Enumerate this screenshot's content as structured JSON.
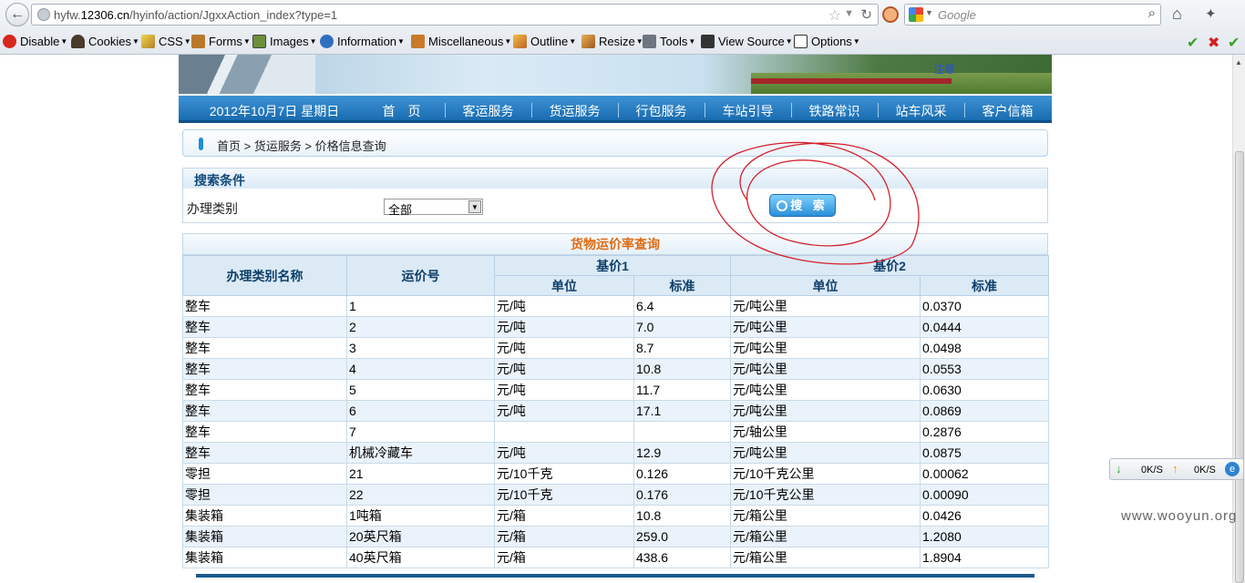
{
  "browser": {
    "url_prefix": "hyfw.",
    "url_domain": "12306.cn",
    "url_path": "/hyinfo/action/JgxxAction_index?type=1",
    "search_engine_placeholder": "Google"
  },
  "devbar": {
    "items": [
      "Disable",
      "Cookies",
      "CSS",
      "Forms",
      "Images",
      "Information",
      "Miscellaneous",
      "Outline",
      "Resize",
      "Tools",
      "View Source",
      "Options"
    ]
  },
  "banner": {
    "note": "注意"
  },
  "nav": {
    "date": "2012年10月7日 星期日",
    "items": [
      "首　页",
      "客运服务",
      "货运服务",
      "行包服务",
      "车站引导",
      "铁路常识",
      "站车风采",
      "客户信箱"
    ]
  },
  "breadcrumb": "首页 > 货运服务 > 价格信息查询",
  "search": {
    "title": "搜索条件",
    "label": "办理类别",
    "select_value": "全部",
    "button_label": "搜 索"
  },
  "rate": {
    "title": "货物运价率查询",
    "headers": {
      "category": "办理类别名称",
      "rate_no": "运价号",
      "base1": "基价1",
      "base2": "基价2",
      "unit": "单位",
      "standard": "标准"
    },
    "rows": [
      [
        "整车",
        "1",
        "元/吨",
        "6.4",
        "元/吨公里",
        "0.0370"
      ],
      [
        "整车",
        "2",
        "元/吨",
        "7.0",
        "元/吨公里",
        "0.0444"
      ],
      [
        "整车",
        "3",
        "元/吨",
        "8.7",
        "元/吨公里",
        "0.0498"
      ],
      [
        "整车",
        "4",
        "元/吨",
        "10.8",
        "元/吨公里",
        "0.0553"
      ],
      [
        "整车",
        "5",
        "元/吨",
        "11.7",
        "元/吨公里",
        "0.0630"
      ],
      [
        "整车",
        "6",
        "元/吨",
        "17.1",
        "元/吨公里",
        "0.0869"
      ],
      [
        "整车",
        "7",
        "",
        "",
        "元/轴公里",
        "0.2876"
      ],
      [
        "整车",
        "机械冷藏车",
        "元/吨",
        "12.9",
        "元/吨公里",
        "0.0875"
      ],
      [
        "零担",
        "21",
        "元/10千克",
        "0.126",
        "元/10千克公里",
        "0.00062"
      ],
      [
        "零担",
        "22",
        "元/10千克",
        "0.176",
        "元/10千克公里",
        "0.00090"
      ],
      [
        "集装箱",
        "1吨箱",
        "元/箱",
        "10.8",
        "元/箱公里",
        "0.0426"
      ],
      [
        "集装箱",
        "20英尺箱",
        "元/箱",
        "259.0",
        "元/箱公里",
        "1.2080"
      ],
      [
        "集装箱",
        "40英尺箱",
        "元/箱",
        "438.6",
        "元/箱公里",
        "1.8904"
      ]
    ]
  },
  "speed": {
    "down": "0K/S",
    "up": "0K/S"
  },
  "watermark": "www.wooyun.org"
}
